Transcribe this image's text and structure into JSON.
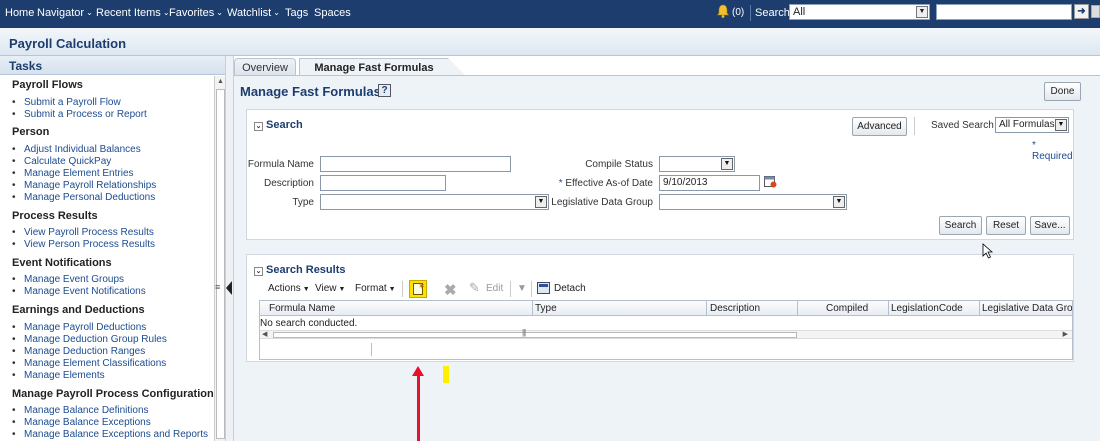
{
  "topnav": {
    "items": [
      {
        "label": "Home",
        "has_menu": false
      },
      {
        "label": "Navigator",
        "has_menu": true
      },
      {
        "label": "Recent Items",
        "has_menu": true
      },
      {
        "label": "Favorites",
        "has_menu": true
      },
      {
        "label": "Watchlist",
        "has_menu": true
      },
      {
        "label": "Tags",
        "has_menu": false
      },
      {
        "label": "Spaces",
        "has_menu": false
      }
    ],
    "notification_count": "(0)",
    "search_label": "Search",
    "search_scope": "All",
    "search_value": "",
    "icons": [
      "bell-icon",
      "go-arrow-icon"
    ]
  },
  "page": {
    "title": "Payroll Calculation"
  },
  "tasks": {
    "header": "Tasks",
    "groups": [
      {
        "title": "Payroll Flows",
        "items": [
          "Submit a Payroll Flow",
          "Submit a Process or Report"
        ]
      },
      {
        "title": "Person",
        "items": [
          "Adjust Individual Balances",
          "Calculate QuickPay",
          "Manage Element Entries",
          "Manage Payroll Relationships",
          "Manage Personal Deductions"
        ]
      },
      {
        "title": "Process Results",
        "items": [
          "View Payroll Process Results",
          "View Person Process Results"
        ]
      },
      {
        "title": "Event Notifications",
        "items": [
          "Manage Event Groups",
          "Manage Event Notifications"
        ]
      },
      {
        "title": "Earnings and Deductions",
        "items": [
          "Manage Payroll Deductions",
          "Manage Deduction Group Rules",
          "Manage Deduction Ranges",
          "Manage Element Classifications",
          "Manage Elements"
        ]
      },
      {
        "title": "Manage Payroll Process Configuration",
        "items": [
          "Manage Balance Definitions",
          "Manage Balance Exceptions",
          "Manage Balance Exceptions and Reports"
        ]
      }
    ]
  },
  "tabs": [
    {
      "label": "Overview",
      "active": false
    },
    {
      "label": "Manage Fast Formulas",
      "active": true
    }
  ],
  "main": {
    "heading": "Manage Fast Formulas",
    "help_glyph": "?",
    "done_label": "Done"
  },
  "search": {
    "title": "Search",
    "advanced_label": "Advanced",
    "saved_search_label": "Saved Search",
    "saved_search_value": "All Formulas",
    "required_note": "* Required",
    "fields": {
      "formula_name_label": "Formula Name",
      "formula_name_value": "",
      "description_label": "Description",
      "description_value": "",
      "type_label": "Type",
      "type_value": "",
      "compile_status_label": "Compile Status",
      "compile_status_value": "",
      "effective_date_label": "Effective As-of Date",
      "effective_date_value": "9/10/2013",
      "ldg_label": "Legislative Data Group",
      "ldg_value": ""
    },
    "buttons": {
      "search": "Search",
      "reset": "Reset",
      "save": "Save..."
    }
  },
  "results": {
    "title": "Search Results",
    "toolbar": {
      "actions": "Actions",
      "view": "View",
      "format": "Format",
      "edit": "Edit",
      "detach": "Detach"
    },
    "columns": [
      "Formula Name",
      "Type",
      "Description",
      "Compiled",
      "LegislationCode",
      "Legislative Data Group"
    ],
    "empty_message": "No search conducted."
  },
  "colors": {
    "nav_bg": "#1c3d6e",
    "title_color": "#1c3d6e",
    "link_color": "#1c4c90",
    "annotation_arrow": "#e8102a",
    "annotation_highlight": "#ffee00"
  }
}
